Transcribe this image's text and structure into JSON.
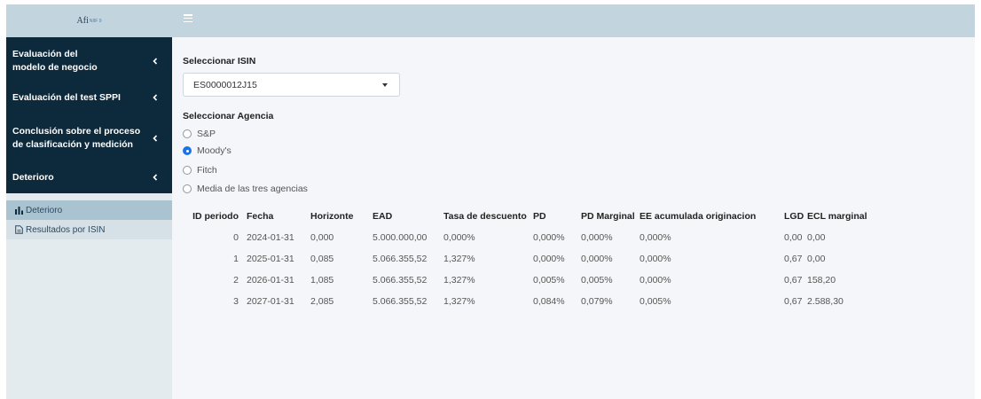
{
  "brand": {
    "name": "Afi",
    "sub": "NIIF 9"
  },
  "sidebar": {
    "items": [
      {
        "label_line1": "Evaluación del",
        "label_line2": "modelo de negocio"
      },
      {
        "label_line1": "Evaluación del test SPPI",
        "label_line2": ""
      },
      {
        "label_line1": "Conclusión sobre el proceso",
        "label_line2": "de clasificación y medición"
      },
      {
        "label_line1": "Deterioro",
        "label_line2": ""
      }
    ],
    "subitems": [
      {
        "label": "Deterioro",
        "icon": "bar-chart-icon",
        "active": true
      },
      {
        "label": "Resultados por ISIN",
        "icon": "file-icon",
        "active": false
      }
    ]
  },
  "main": {
    "isin_label": "Seleccionar ISIN",
    "isin_value": "ES0000012J15",
    "agency_label": "Seleccionar Agencia",
    "agencies": [
      "S&P",
      "Moody's",
      "Fitch",
      "Media de las tres agencias"
    ],
    "selected_agency": "Moody's"
  },
  "table": {
    "headers": [
      "ID periodo",
      "Fecha",
      "Horizonte",
      "EAD",
      "Tasa de descuento",
      "PD",
      "PD Marginal",
      "EE acumulada originacion",
      "LGD",
      "ECL marginal"
    ],
    "rows": [
      [
        "0",
        "2024-01-31",
        "0,000",
        "5.000.000,00",
        "0,000%",
        "0,000%",
        "0,000%",
        "0,000%",
        "0,00",
        "0,00"
      ],
      [
        "1",
        "2025-01-31",
        "0,085",
        "5.066.355,52",
        "1,327%",
        "0,000%",
        "0,000%",
        "0,000%",
        "0,67",
        "0,00"
      ],
      [
        "2",
        "2026-01-31",
        "1,085",
        "5.066.355,52",
        "1,327%",
        "0,005%",
        "0,005%",
        "0,000%",
        "0,67",
        "158,20"
      ],
      [
        "3",
        "2027-01-31",
        "2,085",
        "5.066.355,52",
        "1,327%",
        "0,084%",
        "0,079%",
        "0,005%",
        "0,67",
        "2.588,30"
      ]
    ]
  }
}
